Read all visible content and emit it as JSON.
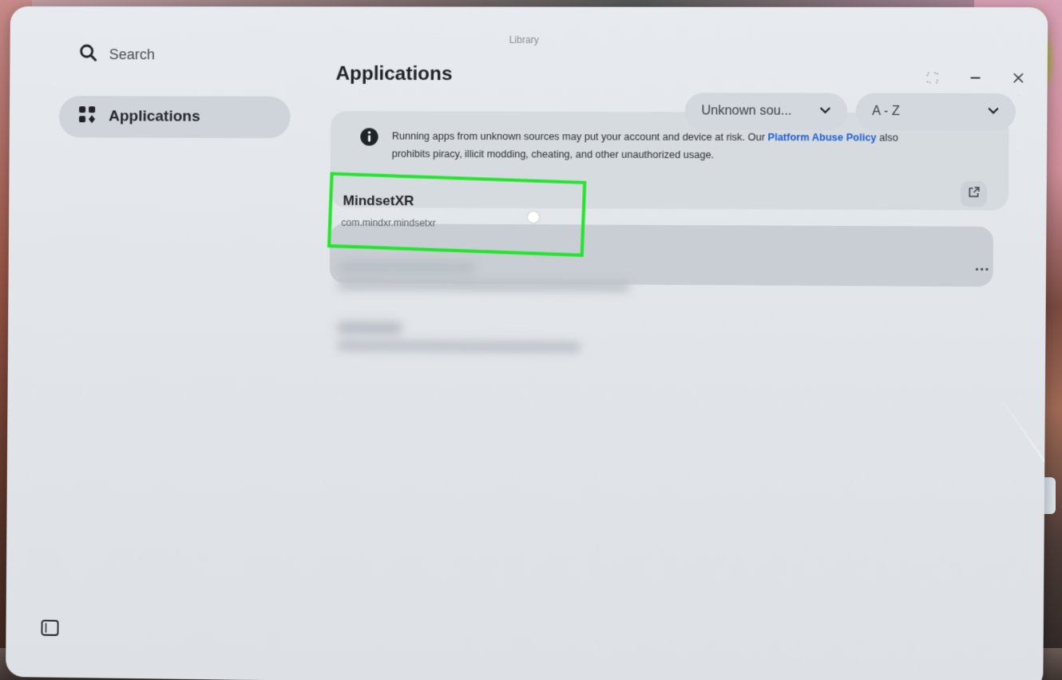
{
  "window": {
    "title": "Library"
  },
  "sidebar": {
    "search_label": "Search",
    "items": [
      {
        "label": "Applications",
        "icon": "apps-grid-icon",
        "selected": true
      }
    ]
  },
  "main": {
    "title": "Applications",
    "filters": {
      "source_selected": "Unknown sou...",
      "sort_selected": "A - Z"
    },
    "notice": {
      "text_part1": "Running apps from unknown sources may put your account and device at risk. Our ",
      "link_text": "Platform Abuse Policy",
      "text_part2": " also prohibits piracy, illicit modding, cheating, and other unauthorized usage."
    },
    "apps": [
      {
        "name": "MindsetXR",
        "package": "com.mindxr.mindsetxr",
        "more_label": "..."
      }
    ]
  },
  "colors": {
    "highlight": "#22e52b",
    "link": "#1b5fd6"
  }
}
